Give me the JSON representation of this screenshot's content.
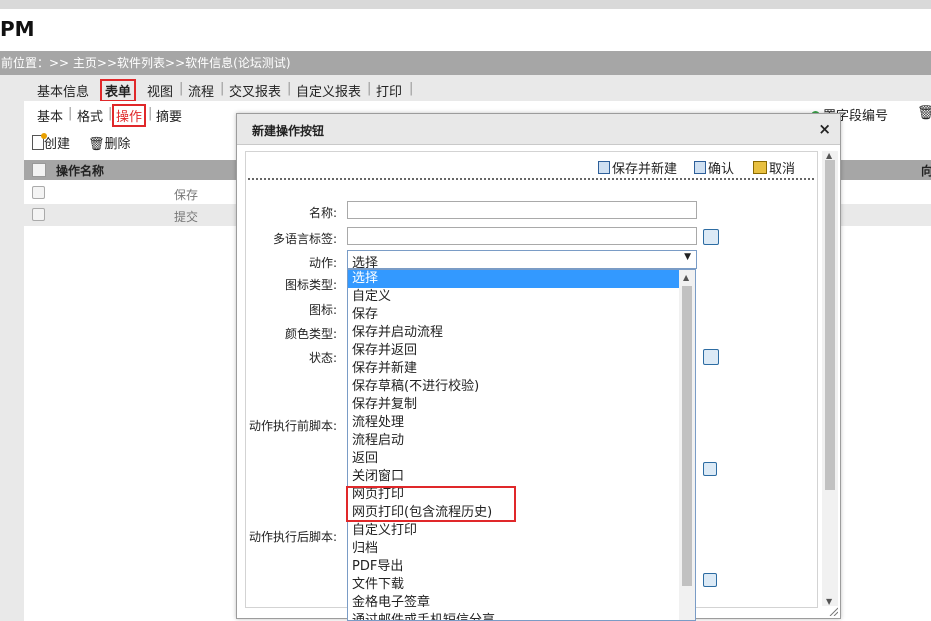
{
  "app": {
    "title": "PM"
  },
  "breadcrumb": {
    "text": "前位置：>> 主页>>软件列表>>软件信息(论坛测试)"
  },
  "tabs_primary": [
    "基本信息",
    "表单",
    "视图",
    "流程",
    "交叉报表",
    "自定义报表",
    "打印"
  ],
  "tabs_secondary": [
    "基本",
    "格式",
    "操作",
    "摘要"
  ],
  "toolbar": {
    "create": "创建",
    "delete": "删除",
    "right_action": "置字段编号"
  },
  "table": {
    "header": "操作名称",
    "right_header": "向",
    "rows": [
      {
        "name": "保存"
      },
      {
        "name": "提交"
      }
    ]
  },
  "modal": {
    "title": "新建操作按钮",
    "close": "×",
    "buttons": {
      "save_new": "保存并新建",
      "confirm": "确认",
      "cancel": "取消"
    },
    "labels": {
      "name": "名称:",
      "i18n": "多语言标签:",
      "action": "动作:",
      "icon_type": "图标类型:",
      "icon": "图标:",
      "color_type": "颜色类型:",
      "status": "状态:",
      "before_script": "动作执行前脚本:",
      "after_script": "动作执行后脚本:"
    },
    "values": {
      "name": "",
      "i18n": ""
    },
    "select": {
      "value": "选择",
      "options": [
        "选择",
        "自定义",
        "保存",
        "保存并启动流程",
        "保存并返回",
        "保存并新建",
        "保存草稿(不进行校验)",
        "保存并复制",
        "流程处理",
        "流程启动",
        "返回",
        "关闭窗口",
        "网页打印",
        "网页打印(包含流程历史)",
        "自定义打印",
        "归档",
        "PDF导出",
        "文件下载",
        "金格电子签章",
        "通过邮件或手机短信分享"
      ]
    }
  },
  "colors": {
    "highlight": "#e0282a",
    "selected_option": "#3399ff",
    "breadcrumb_bg": "#a6a6a6"
  }
}
